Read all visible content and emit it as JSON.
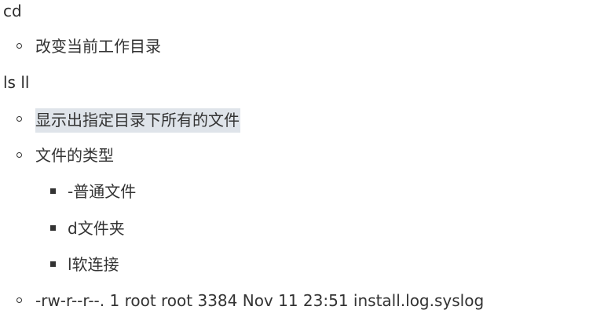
{
  "doc": {
    "cmd_cd": "cd",
    "cd_desc": "改变当前工作目录",
    "cmd_ls": "ls ll",
    "ls_desc": "显示出指定目录下所有的文件",
    "file_types_label": "文件的类型",
    "type_regular": "-普通文件",
    "type_dir": "d文件夹",
    "type_link": "l软连接",
    "example_line": "-rw-r--r--. 1 root root 3384 Nov 11 23:51 install.log.syslog"
  }
}
